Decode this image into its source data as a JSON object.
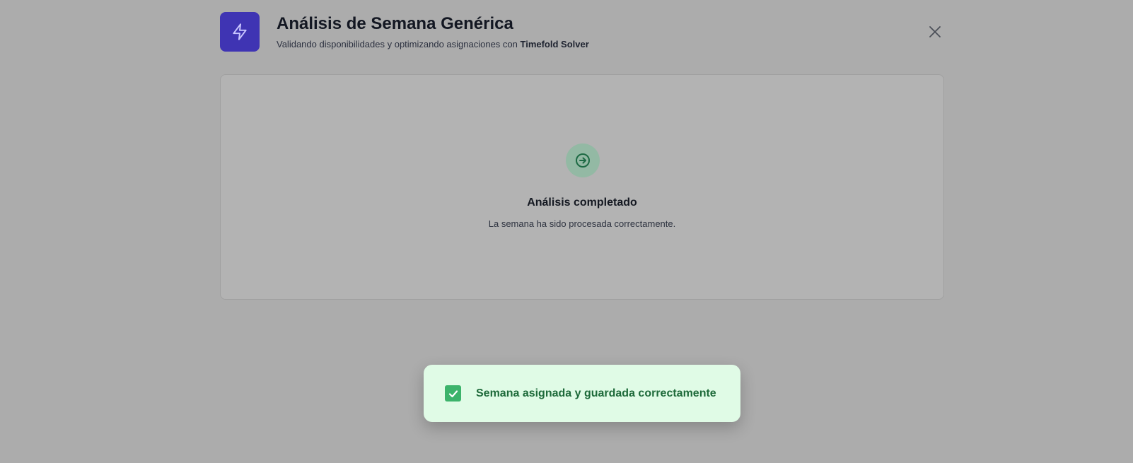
{
  "header": {
    "title": "Análisis de Semana Genérica",
    "subtitle_prefix": "Validando disponibilidades y optimizando asignaciones con ",
    "subtitle_strong": "Timefold Solver",
    "app_icon": "lightning-bolt-icon",
    "close_icon": "close-icon"
  },
  "status": {
    "icon": "arrow-right-circle-icon",
    "title": "Análisis completado",
    "message": "La semana ha sido procesada correctamente."
  },
  "toast": {
    "icon": "check-square-icon",
    "message": "Semana asignada y guardada correctamente"
  },
  "colors": {
    "overlay": "#acacac",
    "brand": "#3f34b3",
    "success_bg": "#e0fbe6",
    "success_text": "#1e6a3a",
    "success_icon": "#3cb36b"
  }
}
